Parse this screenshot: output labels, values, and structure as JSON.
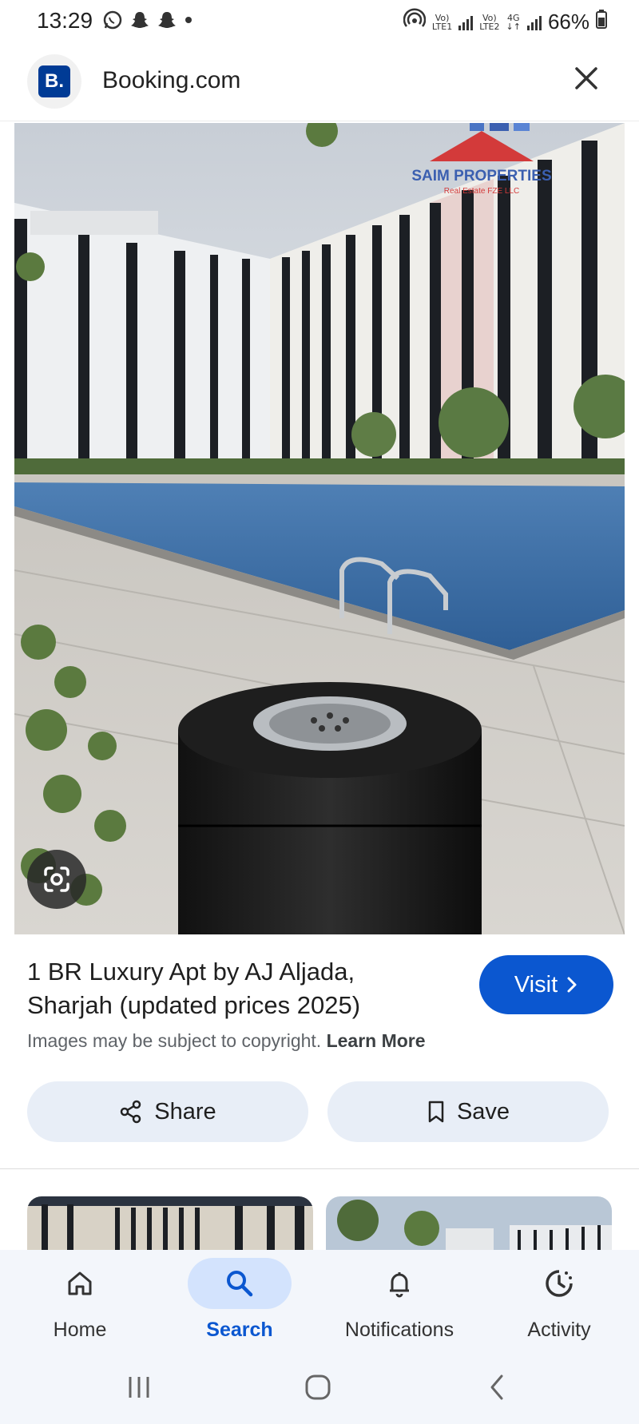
{
  "status_bar": {
    "time": "13:29",
    "network_1_label_top": "Vo)",
    "network_1_label_bottom": "LTE1",
    "network_2_label_top": "Vo)",
    "network_2_label_bottom": "LTE2",
    "network_2_type": "4G",
    "battery": "66%",
    "icons": [
      "whatsapp-icon",
      "snapchat-icon",
      "snapchat-icon",
      "dot-icon",
      "hotspot-icon",
      "signal-icon",
      "battery-icon"
    ]
  },
  "header": {
    "logo_letter": "B.",
    "site_name": "Booking.com",
    "logo_color": "#003b95"
  },
  "image": {
    "watermark_name": "SAIM PROPERTIES",
    "watermark_sub": "Real Estate FZE LLC"
  },
  "result": {
    "title": "1 BR Luxury Apt by AJ Aljada, Sharjah (updated prices 2025)",
    "visit_label": "Visit",
    "copyright_text": "Images may be subject to copyright.",
    "learn_more": "Learn More"
  },
  "actions": {
    "share_label": "Share",
    "save_label": "Save"
  },
  "bottom_nav": {
    "items": [
      {
        "label": "Home",
        "icon": "home-icon"
      },
      {
        "label": "Search",
        "icon": "search-icon",
        "active": true
      },
      {
        "label": "Notifications",
        "icon": "bell-icon"
      },
      {
        "label": "Activity",
        "icon": "activity-icon"
      }
    ]
  },
  "colors": {
    "accent": "#0b57d0",
    "active_pill": "#d3e3fd",
    "action_bg": "#e8eef7"
  }
}
